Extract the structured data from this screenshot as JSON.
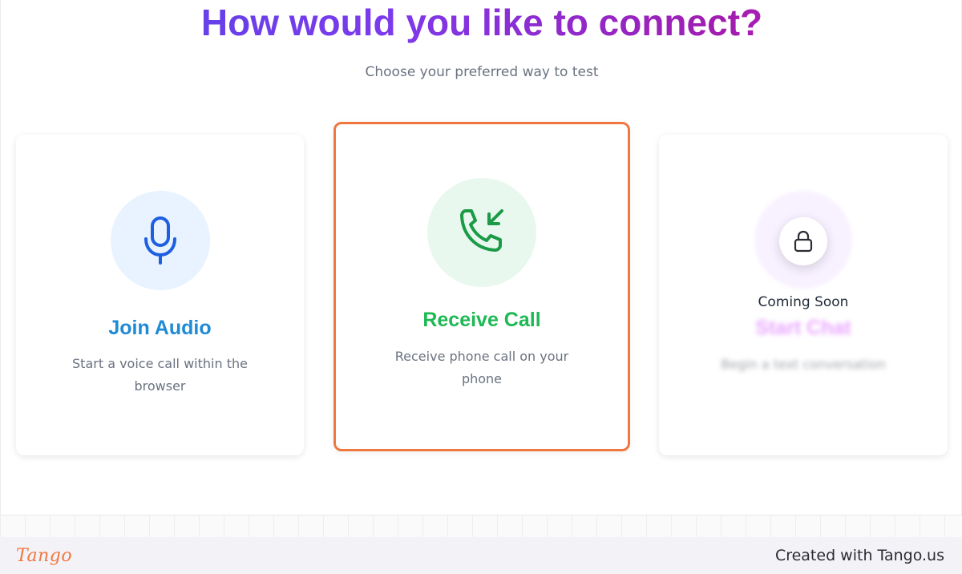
{
  "page": {
    "headline": "How would you like to connect?",
    "subheadline": "Choose your preferred way to test"
  },
  "options": [
    {
      "id": "audio",
      "title": "Join Audio",
      "description": "Start a voice call within the browser",
      "icon": "microphone-icon",
      "accent": "#1f8ad6"
    },
    {
      "id": "call",
      "title": "Receive Call",
      "description": "Receive phone call on your phone",
      "icon": "phone-incoming-icon",
      "accent": "#1db954",
      "highlighted": true
    },
    {
      "id": "chat",
      "title": "Start Chat",
      "description": "Begin a text conversation",
      "icon": "chat-icon",
      "accent": "#e9a5ff",
      "locked": true,
      "badge": "Coming Soon",
      "badge_icon": "lock-icon"
    }
  ],
  "footer": {
    "logo": "Tango",
    "created_with": "Created with Tango.us"
  },
  "colors": {
    "highlight_border": "#f07840",
    "headline_gradient": [
      "#4f46e5",
      "#c026d3"
    ]
  }
}
